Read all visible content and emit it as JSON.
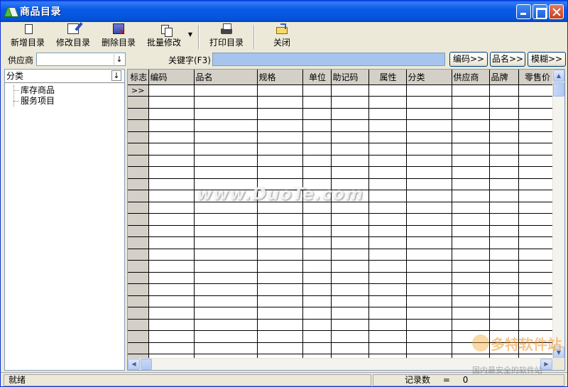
{
  "window": {
    "title": "商品目录"
  },
  "toolbar": {
    "new": "新增目录",
    "edit": "修改目录",
    "delete": "删除目录",
    "batch": "批量修改",
    "print": "打印目录",
    "close": "关闭"
  },
  "filter": {
    "supplier_label": "供应商",
    "supplier_value": "",
    "keyword_label": "关键字(F3)",
    "keyword_value": "",
    "btn_code": "编码>>",
    "btn_name": "品名>>",
    "btn_fuzzy": "模糊>>"
  },
  "category": {
    "header": "分类",
    "items": [
      "库存商品",
      "服务项目"
    ]
  },
  "grid": {
    "columns": [
      "标志",
      "编码",
      "品名",
      "规格",
      "单位",
      "助记码",
      "属性",
      "分类",
      "供应商",
      "品牌",
      "零售价"
    ],
    "current_marker": ">>"
  },
  "watermark": "www.DuoTe.com",
  "logo": {
    "big": "多特软件站",
    "small": "国内最安全的软件站"
  },
  "status": {
    "ready": "就绪",
    "record_label": "记录数",
    "record_eq": "=",
    "record_count": "0"
  },
  "icons": [
    "app-icon",
    "new-doc-icon",
    "edit-icon",
    "delete-icon",
    "batch-icon",
    "printer-icon",
    "close-folder-icon"
  ]
}
